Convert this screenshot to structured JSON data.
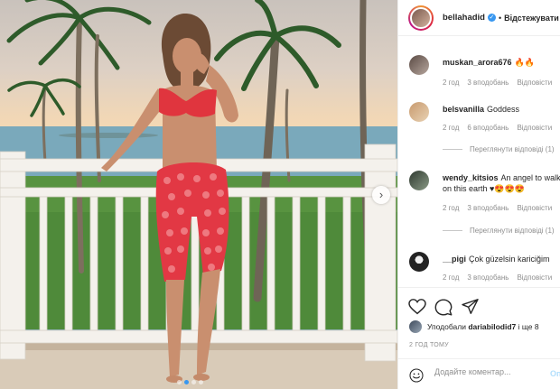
{
  "post_header": {
    "username": "bellahadid",
    "verified_icon": "✓",
    "separator": "•",
    "follow_label": "Відстежувати"
  },
  "comments": [
    {
      "username": "muskan_arora676",
      "text": "🔥🔥",
      "time": "2 год",
      "likes": "3 вподобань",
      "reply": "Відповісти"
    },
    {
      "username": "belsvanilla",
      "text": "Goddess",
      "time": "2 год",
      "likes": "6 вподобань",
      "reply": "Відповісти",
      "view_replies": "Переглянути відповіді (1)"
    },
    {
      "username": "wendy_kitsios",
      "text": "An angel to walk on this earth ♥😍😍😍",
      "text_line1": "An angel to walk",
      "text_line2": "on this earth ♥😍😍😍",
      "time": "2 год",
      "likes": "3 вподобань",
      "reply": "Відповісти",
      "view_replies": "Переглянути відповіді (1)"
    },
    {
      "username": "__pigi",
      "text": "Çok güzelsin kariciğim",
      "time": "2 год",
      "likes": "3 вподобань",
      "reply": "Відповісти"
    }
  ],
  "likes_line": {
    "prefix": "Уподобали",
    "user": "dariabilodid7",
    "suffix": "і ще 8"
  },
  "time_ago": "2 ГОД ТОМУ",
  "comment_box": {
    "placeholder": "Додайте коментар...",
    "post_label": "Опублікувати"
  },
  "carousel": {
    "total_slides": 4,
    "active_index": 1
  },
  "icons": {
    "like": "heart-icon",
    "comment": "comment-icon",
    "share": "share-icon",
    "emoji": "emoji-icon",
    "next": "chevron-right-icon"
  },
  "colors": {
    "accent": "#3897f0",
    "muted": "#8e8e8e",
    "text": "#262626"
  }
}
